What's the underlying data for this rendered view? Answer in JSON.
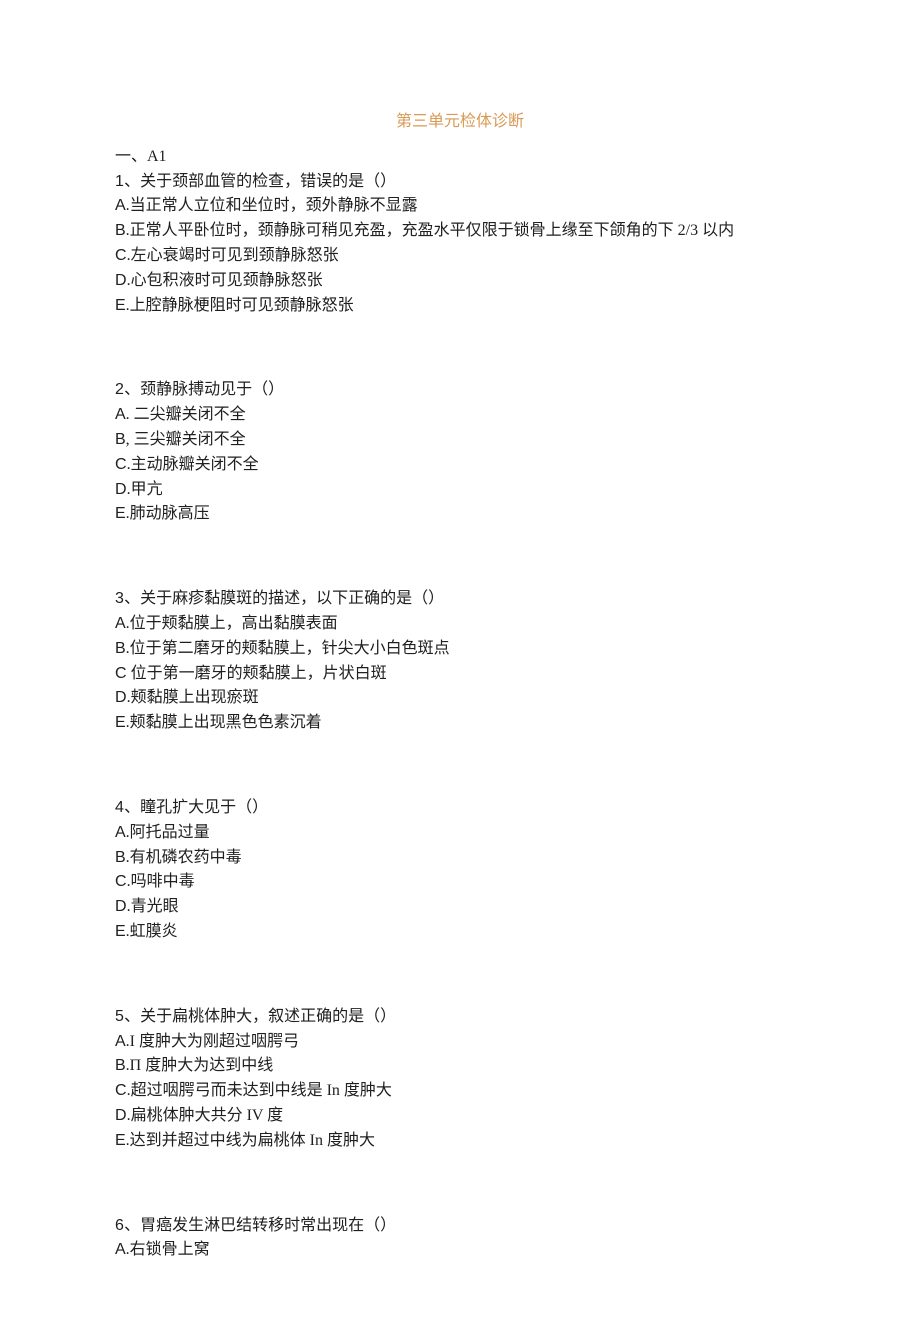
{
  "title": "第三单元检体诊断",
  "sectionLabel": "一、A1",
  "questions": [
    {
      "number": "1",
      "stem": "关于颈部血管的检查，错误的是（）",
      "options": [
        {
          "letter": "A",
          "sep": ".",
          "text": "当正常人立位和坐位时，颈外静脉不显露"
        },
        {
          "letter": "B",
          "sep": ".",
          "text": "正常人平卧位时，颈静脉可稍见充盈，充盈水平仅限于锁骨上缘至下颌角的下 2/3 以内"
        },
        {
          "letter": "C",
          "sep": ".",
          "text": "左心衰竭时可见到颈静脉怒张"
        },
        {
          "letter": "D",
          "sep": ".",
          "text": "心包积液时可见颈静脉怒张"
        },
        {
          "letter": "E",
          "sep": ".",
          "text": "上腔静脉梗阻时可见颈静脉怒张"
        }
      ]
    },
    {
      "number": "2",
      "stem": "颈静脉搏动见于（）",
      "options": [
        {
          "letter": "A",
          "sep": ". ",
          "text": "二尖瓣关闭不全"
        },
        {
          "letter": "B",
          "sep": ", ",
          "text": "三尖瓣关闭不全"
        },
        {
          "letter": "C",
          "sep": ".",
          "text": "主动脉瓣关闭不全"
        },
        {
          "letter": "D",
          "sep": ".",
          "text": "甲亢"
        },
        {
          "letter": "E",
          "sep": ".",
          "text": "肺动脉高压"
        }
      ]
    },
    {
      "number": "3",
      "stem": "关于麻疹黏膜斑的描述，以下正确的是（）",
      "options": [
        {
          "letter": "A",
          "sep": ".",
          "text": "位于颊黏膜上，高出黏膜表面"
        },
        {
          "letter": "B",
          "sep": ".",
          "text": "位于第二磨牙的颊黏膜上，针尖大小白色斑点"
        },
        {
          "letter": "C",
          "sep": " ",
          "text": "位于第一磨牙的颊黏膜上，片状白斑"
        },
        {
          "letter": "D",
          "sep": ".",
          "text": "颊黏膜上出现瘀斑"
        },
        {
          "letter": "E",
          "sep": ".",
          "text": "颊黏膜上出现黑色色素沉着"
        }
      ]
    },
    {
      "number": "4",
      "stem": "瞳孔扩大见于（）",
      "options": [
        {
          "letter": "A",
          "sep": ".",
          "text": "阿托品过量"
        },
        {
          "letter": "B",
          "sep": ".",
          "text": "有机磷农药中毒"
        },
        {
          "letter": "C",
          "sep": ".",
          "text": "吗啡中毒"
        },
        {
          "letter": "D",
          "sep": ".",
          "text": "青光眼"
        },
        {
          "letter": "E",
          "sep": ".",
          "text": "虹膜炎"
        }
      ]
    },
    {
      "number": "5",
      "stem": "关于扁桃体肿大，叙述正确的是（）",
      "options": [
        {
          "letter": "A",
          "sep": ".",
          "text": "I 度肿大为刚超过咽腭弓"
        },
        {
          "letter": "B",
          "sep": ".",
          "text": "Π 度肿大为达到中线"
        },
        {
          "letter": "C",
          "sep": ".",
          "text": "超过咽腭弓而未达到中线是 In 度肿大"
        },
        {
          "letter": "D",
          "sep": ".",
          "text": "扁桃体肿大共分 IV 度"
        },
        {
          "letter": "E",
          "sep": ".",
          "text": "达到并超过中线为扁桃体 In 度肿大"
        }
      ]
    },
    {
      "number": "6",
      "stem": "胃癌发生淋巴结转移时常出现在（）",
      "options": [
        {
          "letter": "A",
          "sep": ".",
          "text": "右锁骨上窝"
        }
      ]
    }
  ]
}
